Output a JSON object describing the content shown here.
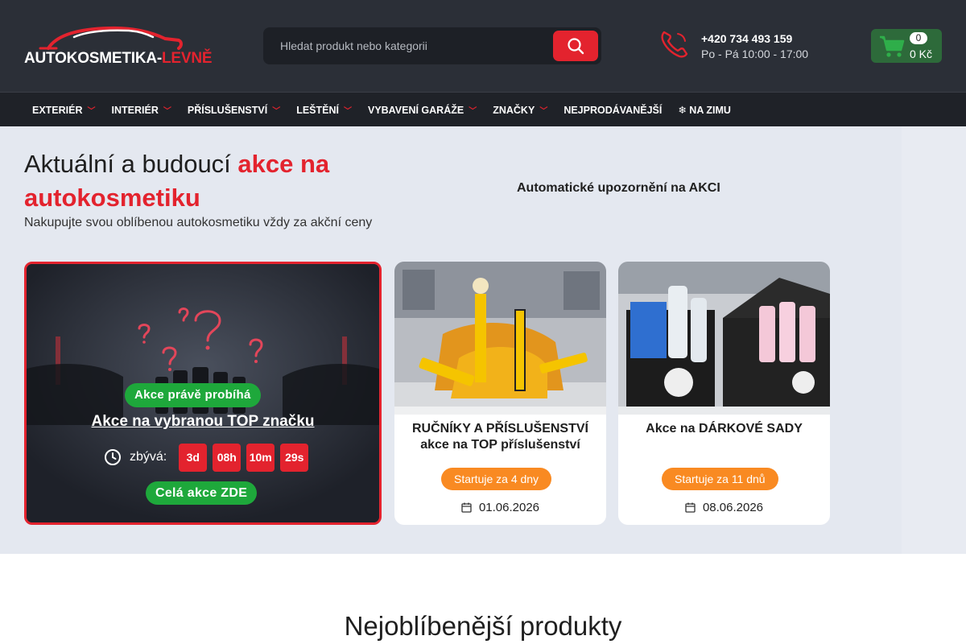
{
  "header": {
    "logo": {
      "text_white": "AUTOKOSMETIKA-",
      "text_red": "LEVNĚ"
    },
    "search": {
      "placeholder": "Hledat produkt nebo kategorii"
    },
    "contact": {
      "phone": "+420 734 493 159",
      "hours": "Po - Pá 10:00 - 17:00"
    },
    "cart": {
      "count": "0",
      "total": "0 Kč"
    }
  },
  "nav": {
    "items": [
      {
        "label": "EXTERIÉR",
        "has_dropdown": true
      },
      {
        "label": "INTERIÉR",
        "has_dropdown": true
      },
      {
        "label": "PŘÍSLUŠENSTVÍ",
        "has_dropdown": true
      },
      {
        "label": "LEŠTĚNÍ",
        "has_dropdown": true
      },
      {
        "label": "VYBAVENÍ GARÁŽE",
        "has_dropdown": true
      },
      {
        "label": "ZNAČKY",
        "has_dropdown": true
      },
      {
        "label": "NEJPRODÁVANĚJŠÍ",
        "has_dropdown": false
      },
      {
        "label": "❄ NA ZIMU",
        "has_dropdown": false
      }
    ]
  },
  "hero": {
    "title_plain": "Aktuální a budoucí ",
    "title_highlight": "akce na autokosmetiku",
    "subtitle": "Nakupujte svou oblíbenou autokosmetiku vždy za akční ceny",
    "notify_link": "Automatické upozornění na AKCI"
  },
  "active_deal": {
    "badge": " Akce právě probíhá",
    "title": "Akce na vybranou TOP značku",
    "remaining_label": "zbývá:",
    "countdown": {
      "days": "3d",
      "hours": "08h",
      "minutes": "10m",
      "seconds": "29s"
    },
    "cta": "Celá akce ZDE"
  },
  "upcoming": [
    {
      "title_line1": "RUČNÍKY A PŘÍSLUŠENSTVÍ",
      "title_line2": "akce na TOP příslušenství",
      "start": " Startuje za 4 dny",
      "date": "01.06.2026"
    },
    {
      "title_line1": "Akce na DÁRKOVÉ SADY",
      "title_line2": "",
      "start": " Startuje za 11 dnů",
      "date": "08.06.2026"
    }
  ],
  "popular": {
    "title": "Nejoblíbenější produkty"
  },
  "colors": {
    "accent_red": "#e3232e",
    "header_dark": "#2b2f37",
    "green": "#1ea83b",
    "orange": "#f98a22",
    "hero_bg": "#e4e8f0"
  }
}
